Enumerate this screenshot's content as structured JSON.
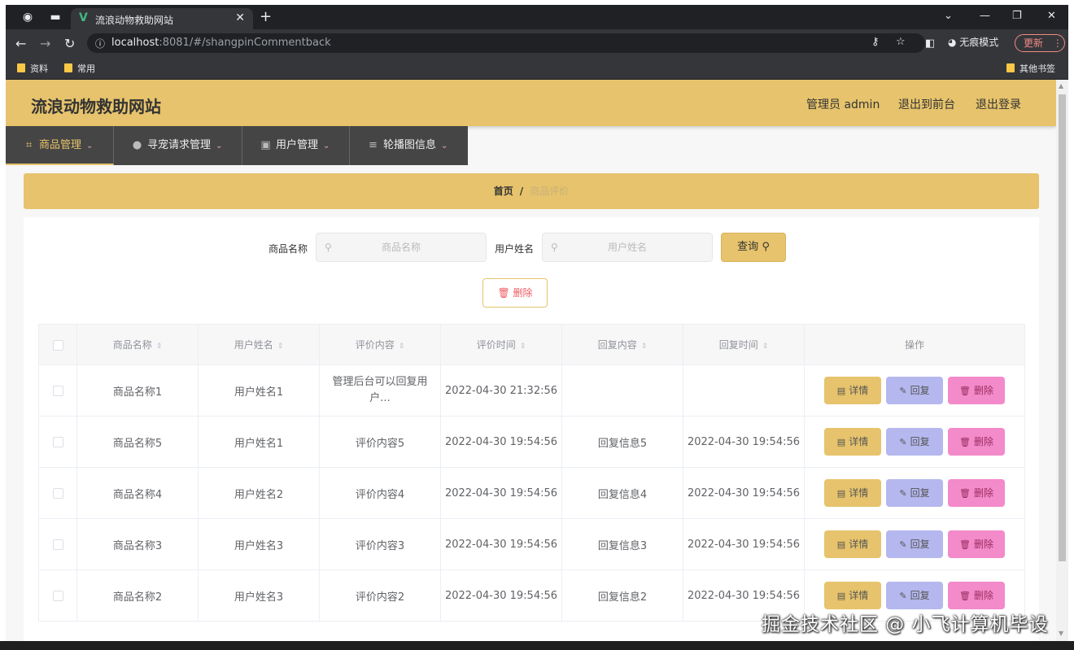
{
  "browser": {
    "tab_title": "流浪动物救助网站",
    "url_host": "localhost",
    "url_path": ":8081/#/shangpinCommentback",
    "incognito_label": "无痕模式",
    "update_label": "更新",
    "bookmarks": [
      "资料",
      "常用"
    ],
    "other_bookmarks": "其他书签"
  },
  "header": {
    "site_title": "流浪动物救助网站",
    "admin_label": "管理员 admin",
    "exit_front": "退出到前台",
    "logout": "退出登录"
  },
  "menu": [
    {
      "label": "商品管理",
      "icon": "crop-icon",
      "active": true
    },
    {
      "label": "寻宠请求管理",
      "icon": "user-icon",
      "active": false
    },
    {
      "label": "用户管理",
      "icon": "image-icon",
      "active": false
    },
    {
      "label": "轮播图信息",
      "icon": "list-icon",
      "active": false
    }
  ],
  "breadcrumb": {
    "home": "首页",
    "separator": "/",
    "current": "商品评价"
  },
  "search": {
    "product_label": "商品名称",
    "product_placeholder": "商品名称",
    "user_label": "用户姓名",
    "user_placeholder": "用户姓名",
    "query_button": "查询",
    "delete_button": "删除"
  },
  "table": {
    "headers": [
      "商品名称",
      "用户姓名",
      "评价内容",
      "评价时间",
      "回复内容",
      "回复时间",
      "操作"
    ],
    "actions": {
      "detail": "详情",
      "reply": "回复",
      "delete": "删除"
    },
    "rows": [
      {
        "product": "商品名称1",
        "user": "用户姓名1",
        "content": "管理后台可以回复用户...",
        "time": "2022-04-30 21:32:56",
        "reply": "",
        "reply_time": ""
      },
      {
        "product": "商品名称5",
        "user": "用户姓名1",
        "content": "评价内容5",
        "time": "2022-04-30 19:54:56",
        "reply": "回复信息5",
        "reply_time": "2022-04-30 19:54:56"
      },
      {
        "product": "商品名称4",
        "user": "用户姓名2",
        "content": "评价内容4",
        "time": "2022-04-30 19:54:56",
        "reply": "回复信息4",
        "reply_time": "2022-04-30 19:54:56"
      },
      {
        "product": "商品名称3",
        "user": "用户姓名3",
        "content": "评价内容3",
        "time": "2022-04-30 19:54:56",
        "reply": "回复信息3",
        "reply_time": "2022-04-30 19:54:56"
      },
      {
        "product": "商品名称2",
        "user": "用户姓名3",
        "content": "评价内容2",
        "time": "2022-04-30 19:54:56",
        "reply": "回复信息2",
        "reply_time": "2022-04-30 19:54:56"
      }
    ]
  },
  "watermark": "掘金技术社区 @ 小飞计算机毕设",
  "colors": {
    "accent": "#e6c36c",
    "menu_bg": "#454545",
    "reply_btn": "#b5b8ee",
    "delete_btn": "#f38ac9"
  }
}
